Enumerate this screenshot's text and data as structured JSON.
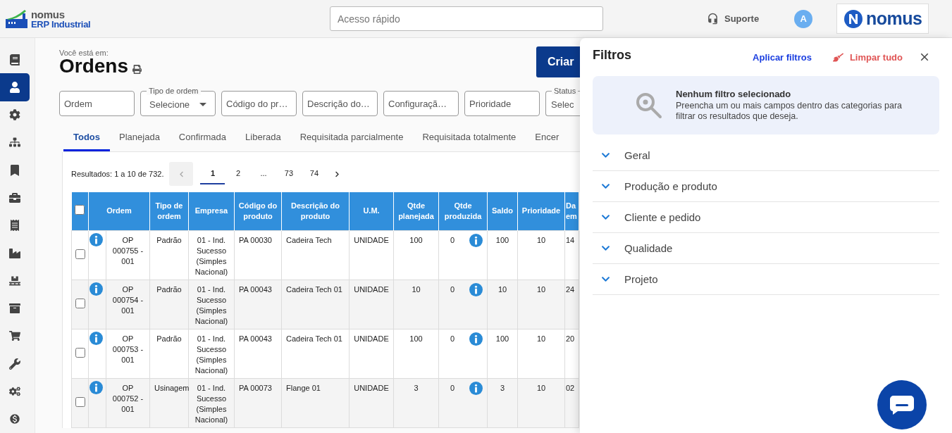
{
  "header": {
    "logo_top": "nomus",
    "logo_bottom": "ERP Industrial",
    "search_placeholder": "Acesso rápido",
    "support": "Suporte",
    "avatar": "A",
    "brand": "nomus"
  },
  "sidebar": {
    "items": [
      {
        "kind": "book",
        "selected": false
      },
      {
        "kind": "person",
        "selected": true
      },
      {
        "kind": "gear",
        "selected": false
      },
      {
        "kind": "hierarchy",
        "selected": false
      },
      {
        "kind": "bookmark",
        "selected": false
      },
      {
        "kind": "briefcase",
        "selected": false
      },
      {
        "kind": "receipt",
        "selected": false
      },
      {
        "kind": "factory",
        "selected": false
      },
      {
        "kind": "pallet",
        "selected": false
      },
      {
        "kind": "archive",
        "selected": false
      },
      {
        "kind": "cart",
        "selected": false
      },
      {
        "kind": "wrench",
        "selected": false
      },
      {
        "kind": "gears",
        "selected": false
      },
      {
        "kind": "dollar",
        "selected": false
      }
    ]
  },
  "page": {
    "breadcrumb": "Você está em:",
    "title": "Ordens",
    "create_button": "Criar"
  },
  "filters": [
    {
      "kind": "text",
      "placeholder": "Ordem"
    },
    {
      "kind": "select",
      "label": "Tipo de ordem",
      "value": "Selecione",
      "caret": true
    },
    {
      "kind": "text",
      "placeholder": "Código do pr…"
    },
    {
      "kind": "text",
      "placeholder": "Descrição do…"
    },
    {
      "kind": "text",
      "placeholder": "Configuraçã…"
    },
    {
      "kind": "text",
      "placeholder": "Prioridade"
    },
    {
      "kind": "select",
      "label": "Status",
      "value": "Selec",
      "caret": false
    }
  ],
  "tabs": [
    {
      "label": "Todos",
      "selected": true
    },
    {
      "label": "Planejada",
      "selected": false
    },
    {
      "label": "Confirmada",
      "selected": false
    },
    {
      "label": "Liberada",
      "selected": false
    },
    {
      "label": "Requisitada parcialmente",
      "selected": false
    },
    {
      "label": "Requisitada totalmente",
      "selected": false
    },
    {
      "label": "Encer",
      "selected": false
    }
  ],
  "results": {
    "text": "Resultados: 1 a 10 de 732.",
    "pages": [
      {
        "label": "1",
        "selected": true
      },
      {
        "label": "2",
        "selected": false
      },
      {
        "label": "...",
        "selected": false
      },
      {
        "label": "73",
        "selected": false
      },
      {
        "label": "74",
        "selected": false
      }
    ]
  },
  "table": {
    "header_checked": false,
    "columns": [
      "Ordem",
      "Tipo de ordem",
      "Empresa",
      "Código do produto",
      "Descrição do produto",
      "U.M.",
      "Qtde planejada",
      "Qtde produzida",
      "Saldo",
      "Prioridade",
      "Da em"
    ],
    "rows": [
      {
        "checked": false,
        "ordem": "OP 000755 - 001",
        "tipo": "Padrão",
        "empresa": "01 - Ind. Sucesso (Simples Nacional)",
        "codigo": "PA 00030",
        "descricao": "Cadeira Tech",
        "um": "UNIDADE",
        "planejada": "100",
        "produzida": "0",
        "saldo": "100",
        "prioridade": "10",
        "data": "14"
      },
      {
        "checked": false,
        "ordem": "OP 000754 - 001",
        "tipo": "Padrão",
        "empresa": "01 - Ind. Sucesso (Simples Nacional)",
        "codigo": "PA 00043",
        "descricao": "Cadeira Tech 01",
        "um": "UNIDADE",
        "planejada": "10",
        "produzida": "0",
        "saldo": "10",
        "prioridade": "10",
        "data": "24"
      },
      {
        "checked": false,
        "ordem": "OP 000753 - 001",
        "tipo": "Padrão",
        "empresa": "01 - Ind. Sucesso (Simples Nacional)",
        "codigo": "PA 00043",
        "descricao": "Cadeira Tech 01",
        "um": "UNIDADE",
        "planejada": "100",
        "produzida": "0",
        "saldo": "100",
        "prioridade": "10",
        "data": "20"
      },
      {
        "checked": false,
        "ordem": "OP 000752 - 001",
        "tipo": "Usinagem",
        "empresa": "01 - Ind. Sucesso (Simples Nacional)",
        "codigo": "PA 00073",
        "descricao": "Flange 01",
        "um": "UNIDADE",
        "planejada": "3",
        "produzida": "0",
        "saldo": "3",
        "prioridade": "10",
        "data": "02"
      }
    ]
  },
  "filter_panel": {
    "title": "Filtros",
    "apply": "Aplicar filtros",
    "clear": "Limpar tudo",
    "notice_title": "Nenhum filtro selecionado",
    "notice_text": "Preencha um ou mais campos dentro das categorias para filtrar os resultados que deseja.",
    "categories": [
      {
        "label": "Geral",
        "expanded": false
      },
      {
        "label": "Produção e produto",
        "expanded": false
      },
      {
        "label": "Cliente e pedido",
        "expanded": false
      },
      {
        "label": "Qualidade",
        "expanded": false
      },
      {
        "label": "Projeto",
        "expanded": false
      }
    ]
  }
}
